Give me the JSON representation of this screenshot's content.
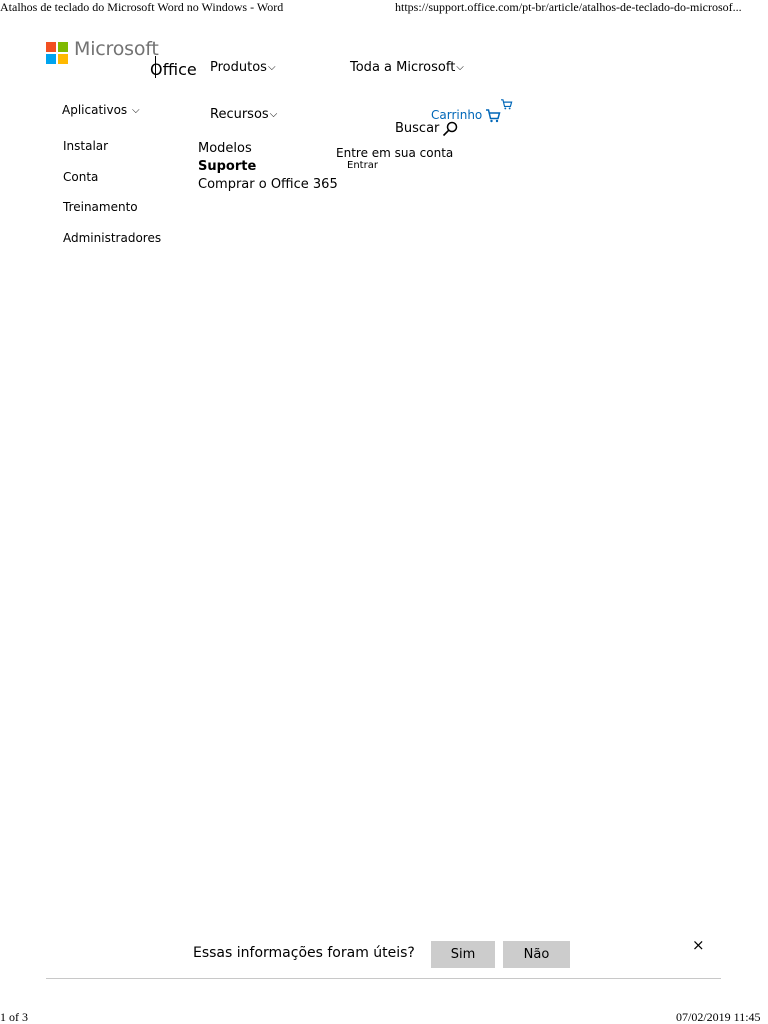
{
  "print_header": {
    "title": "Atalhos de teclado do Microsoft Word no Windows - Word",
    "url": "https://support.office.com/pt-br/article/atalhos-de-teclado-do-microsof..."
  },
  "brand": {
    "microsoft": "Microsoft",
    "office": "Office",
    "logo_colors": [
      "#f25022",
      "#7fba00",
      "#00a4ef",
      "#ffb900"
    ]
  },
  "nav": {
    "produtos": "Produtos",
    "toda_microsoft": "Toda a Microsoft",
    "aplicativos": "Aplicativos",
    "recursos": "Recursos",
    "chevron": "⌵"
  },
  "apps_menu": [
    "Instalar",
    "Conta",
    "Treinamento",
    "Administradores"
  ],
  "resources_menu": {
    "modelos": "Modelos",
    "suporte": "Suporte",
    "comprar": "Comprar o Office 365"
  },
  "account": {
    "cart_label": "Carrinho",
    "search_label": "Buscar",
    "signin_prompt": "Entre em sua conta",
    "signin": "Entrar"
  },
  "icons": {
    "cart": "cart-icon",
    "search": "search-icon",
    "close": "close-icon"
  },
  "feedback": {
    "question": "Essas informações foram úteis?",
    "yes": "Sim",
    "no": "Não",
    "close": "×"
  },
  "print_footer": {
    "page": "1 of 3",
    "datetime": "07/02/2019 11:45"
  },
  "colors": {
    "link_blue": "#0067b8",
    "button_gray": "#cccccc",
    "logo_text_gray": "#737373"
  }
}
